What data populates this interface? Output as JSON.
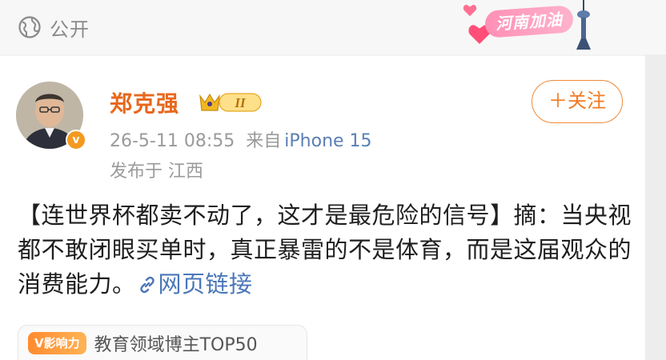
{
  "header": {
    "visibility": "公开",
    "sticker_text": "河南加油"
  },
  "post": {
    "author": "郑克强",
    "member_level": "II",
    "verified_badge": "v",
    "time": "26-5-11 08:55",
    "source_label": "来自",
    "device": "iPhone 15",
    "location": "发布于 江西",
    "follow_label": "＋关注",
    "content_text": "【连世界杯都卖不动了，这才是最危险的信号】摘：当央视都不敢闭眼买单时，真正暴雷的不是体育，而是这届观众的消费能力。",
    "link_label": "网页链接",
    "tag_badge": "V影响力",
    "tag_text": "教育领域博主TOP50"
  },
  "colors": {
    "author": "#e8671c",
    "link": "#4a76b8",
    "follow": "#f07a22",
    "badge": "#f39a1f"
  },
  "icons": [
    "globe-icon",
    "crown-icon",
    "verified-icon",
    "link-icon",
    "heart-icon",
    "tower-icon"
  ]
}
